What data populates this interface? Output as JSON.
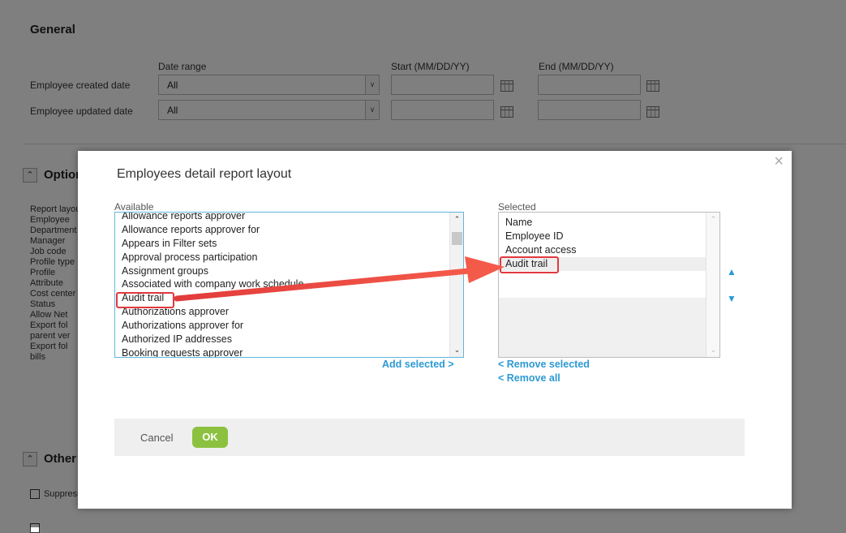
{
  "general": {
    "title": "General",
    "date_range_header": "Date range",
    "start_header": "Start (MM/DD/YY)",
    "end_header": "End (MM/DD/YY)",
    "rows": [
      {
        "label": "Employee created date",
        "value": "All"
      },
      {
        "label": "Employee updated date",
        "value": "All"
      }
    ]
  },
  "options_section": {
    "title": "Options",
    "items": [
      "Report layout",
      "Employee",
      "Department",
      "Manager",
      "Job code",
      "Profile type",
      "Profile",
      "Attribute",
      "Cost center",
      "Status",
      "Allow Net",
      "Export fol",
      "parent ver",
      "Export fol",
      "bills"
    ]
  },
  "other_section": {
    "title": "Other",
    "checkbox_label": "Suppress"
  },
  "modal": {
    "title": "Employees detail report layout",
    "available_label": "Available",
    "selected_label": "Selected",
    "available_items": [
      "Allowance reports approver",
      "Allowance reports approver for",
      "Appears in Filter sets",
      "Approval process participation",
      "Assignment groups",
      "Associated with company work schedule",
      "Audit trail",
      "Authorizations approver",
      "Authorizations approver for",
      "Authorized IP addresses",
      "Booking requests approver"
    ],
    "selected_items": [
      "Name",
      "Employee ID",
      "Account access",
      "Audit trail"
    ],
    "add_selected": "Add selected >",
    "remove_selected": "< Remove selected",
    "remove_all": "< Remove all",
    "cancel": "Cancel",
    "ok": "OK",
    "close_glyph": "×",
    "move_up_glyph": "▲",
    "move_down_glyph": "▼"
  },
  "colors": {
    "link": "#2c9ad3",
    "ok_button": "#8bc13f",
    "highlight": "#e0393e"
  }
}
